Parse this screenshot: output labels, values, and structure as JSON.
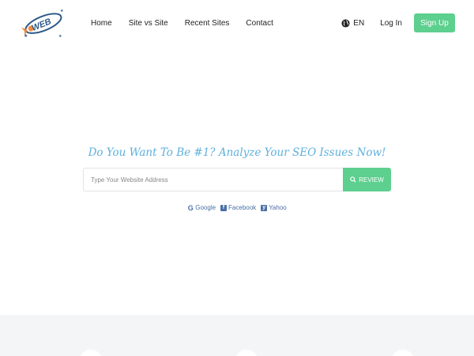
{
  "brand": {
    "logo_text": "WEB"
  },
  "nav": {
    "links": [
      "Home",
      "Site vs Site",
      "Recent Sites",
      "Contact"
    ],
    "language": "EN",
    "login": "Log In",
    "signup": "Sign Up"
  },
  "hero": {
    "headline": "Do You Want To Be #1? Analyze Your SEO Issues Now!",
    "search_placeholder": "Type Your Website Address",
    "review_label": "REVIEW"
  },
  "social": [
    {
      "icon": "google-icon",
      "label": "Google"
    },
    {
      "icon": "facebook-icon",
      "label": "Facebook"
    },
    {
      "icon": "yahoo-icon",
      "label": "Yahoo"
    }
  ],
  "colors": {
    "accent": "#5dcf8e",
    "headline": "#5eb0dc",
    "link": "#4a6fa5",
    "band": "#f4f5f7"
  }
}
